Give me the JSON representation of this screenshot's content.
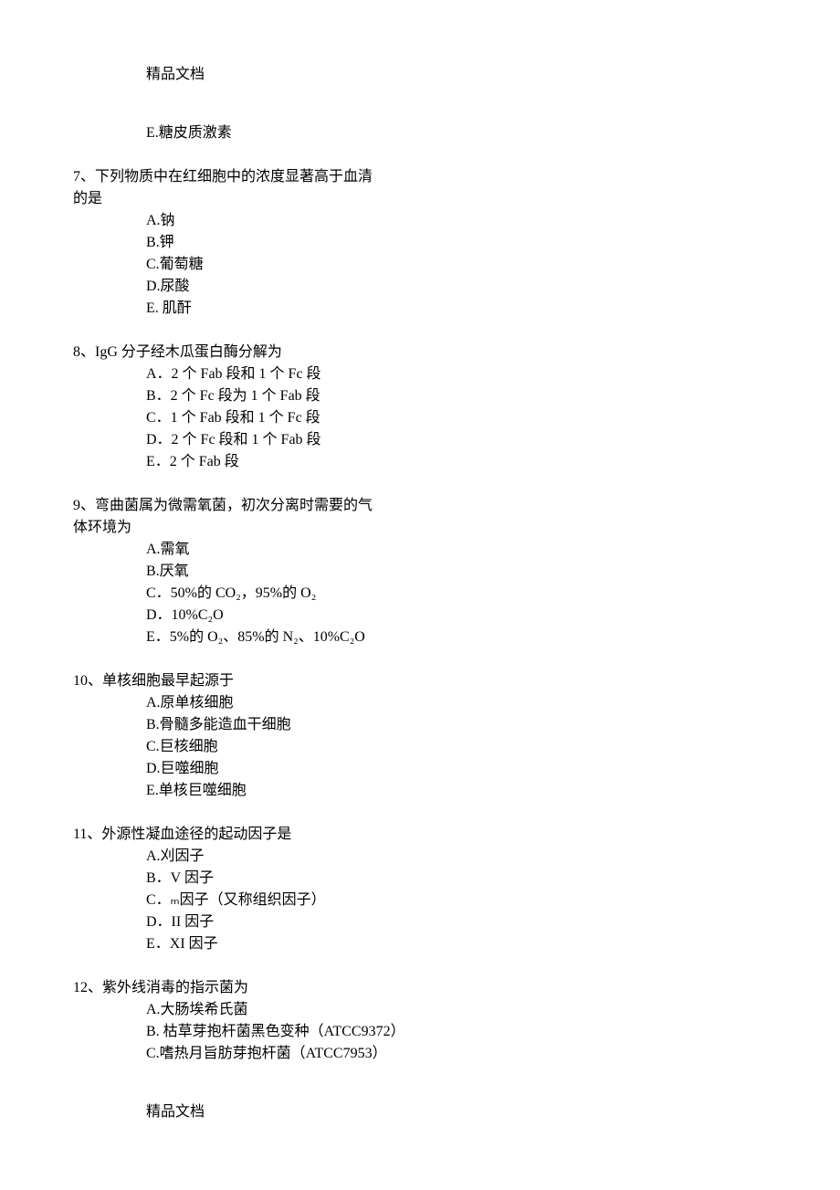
{
  "header": "精品文档",
  "footer": "精品文档",
  "continued_option": "E.糖皮质激素",
  "questions": [
    {
      "num": "7、",
      "stem_lines": [
        "下列物质中在红细胞中的浓度显著高于血清",
        "的是"
      ],
      "options": [
        "A.钠",
        "B.钾",
        "C.葡萄糖",
        "D.尿酸",
        "E. 肌酐"
      ]
    },
    {
      "num": "8、",
      "stem_lines": [
        "IgG 分子经木瓜蛋白酶分解为"
      ],
      "options": [
        "A．2 个 Fab 段和 1 个 Fc 段",
        "B．2 个 Fc 段为 1 个 Fab 段",
        "C．1 个 Fab 段和 1 个 Fc 段",
        "D．2 个 Fc 段和 1 个 Fab 段",
        "E．2 个 Fab 段"
      ]
    },
    {
      "num": "9、",
      "stem_lines": [
        "弯曲菌属为微需氧菌，初次分离时需要的气",
        "体环境为"
      ],
      "options": [
        "A.需氧",
        "B.厌氧",
        "C．50%的 CO₂，95%的 O₂",
        "D．10%C₂O",
        "E．5%的 O₂、85%的 N₂、10%C₂O"
      ]
    },
    {
      "num": "10、",
      "stem_lines": [
        "单核细胞最早起源于"
      ],
      "options": [
        "A.原单核细胞",
        "B.骨髓多能造血干细胞",
        "C.巨核细胞",
        "D.巨噬细胞",
        "E.单核巨噬细胞"
      ]
    },
    {
      "num": "11、",
      "stem_lines": [
        "外源性凝血途径的起动因子是"
      ],
      "options": [
        "A.刈因子",
        "B．V 因子",
        "C．ₘ因子（又称组织因子）",
        "D．II 因子",
        "E．XI 因子"
      ]
    },
    {
      "num": "12、",
      "stem_lines": [
        "紫外线消毒的指示菌为"
      ],
      "options": [
        "A.大肠埃希氏菌",
        "B. 枯草芽抱杆菌黑色变种（ATCC9372）",
        "C.嗜热月旨肪芽抱杆菌（ATCC7953）"
      ]
    }
  ]
}
